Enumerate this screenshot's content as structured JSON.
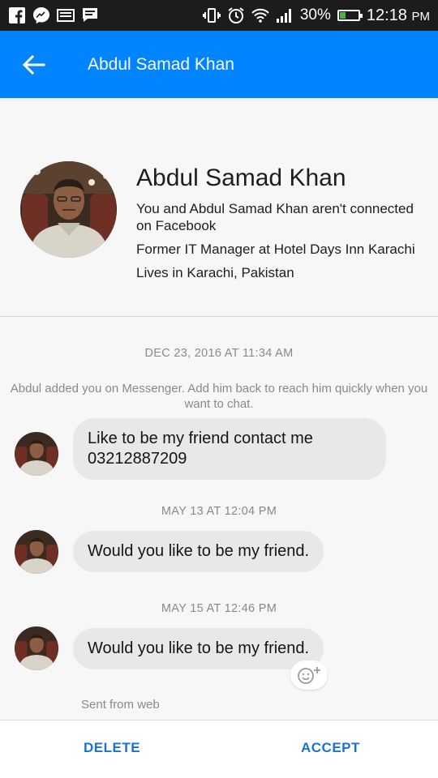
{
  "status_bar": {
    "battery_percent": "30%",
    "time": "12:18",
    "ampm": "PM",
    "left_icons": [
      "facebook-icon",
      "messenger-icon",
      "media-icon",
      "chat-notification-icon"
    ],
    "right_icons": [
      "vibrate-icon",
      "alarm-icon",
      "wifi-icon",
      "signal-icon",
      "battery-icon"
    ],
    "battery_level": 0.3
  },
  "app_bar": {
    "title": "Abdul Samad Khan",
    "color": "#0084ff"
  },
  "profile": {
    "name": "Abdul Samad Khan",
    "connection": "You and Abdul Samad Khan aren't connected on Facebook",
    "work": "Former IT Manager at Hotel Days Inn Karachi",
    "location": "Lives in Karachi, Pakistan"
  },
  "conversation": {
    "timestamp_1": "DEC 23, 2016 AT 11:34 AM",
    "system_message": "Abdul added you on Messenger. Add him back to reach him quickly when you want to chat.",
    "message_1": "Like to be my friend contact me 03212887209",
    "timestamp_2": "MAY 13 AT 12:04 PM",
    "message_2": "Would you like to be my friend.",
    "timestamp_3": "MAY 15 AT 12:46 PM",
    "message_3": "Would you like to be my friend.",
    "sent_from": "Sent from web"
  },
  "actions": {
    "delete_label": "DELETE",
    "accept_label": "ACCEPT",
    "color": "#1a73d0"
  }
}
